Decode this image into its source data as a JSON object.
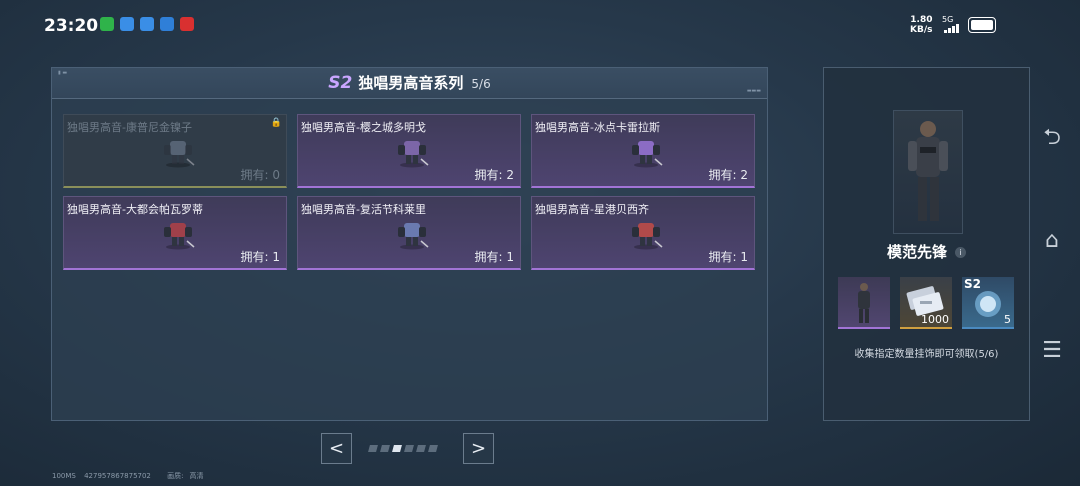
{
  "status": {
    "time": "23:20",
    "net_speed": "1.80",
    "net_unit": "KB/s",
    "signal": "5G"
  },
  "panel": {
    "season_tag": "S2",
    "title": "独唱男高音系列",
    "count": "5/6",
    "cards": [
      {
        "name": "独唱男高音-康普尼金镍子",
        "owned": "拥有: 0",
        "locked": true,
        "accent": "#7b8aa0"
      },
      {
        "name": "独唱男高音-樱之城多明戈",
        "owned": "拥有: 2",
        "locked": false,
        "accent": "#7c66a8"
      },
      {
        "name": "独唱男高音-冰点卡雷拉斯",
        "owned": "拥有: 2",
        "locked": false,
        "accent": "#8b6cc4"
      },
      {
        "name": "独唱男高音-大都会帕瓦罗蒂",
        "owned": "拥有: 1",
        "locked": false,
        "accent": "#a0404a"
      },
      {
        "name": "独唱男高音-复活节科莱里",
        "owned": "拥有: 1",
        "locked": false,
        "accent": "#6a7ab0"
      },
      {
        "name": "独唱男高音-星港贝西齐",
        "owned": "拥有: 1",
        "locked": false,
        "accent": "#b04a4a"
      }
    ]
  },
  "pager": {
    "prev": "<",
    "next": ">",
    "pages": 6,
    "current": 2
  },
  "footer": {
    "ping": "100MS",
    "uid": "427957867875702",
    "quality_label": "画质:",
    "quality_value": "高清"
  },
  "reward": {
    "name": "模范先锋",
    "items": [
      {
        "type": "character",
        "qty": "",
        "tag": ""
      },
      {
        "type": "voucher",
        "qty": "1000",
        "tag": ""
      },
      {
        "type": "s2-emblem",
        "qty": "5",
        "tag": "S2"
      }
    ],
    "description": "收集指定数量挂饰即可领取(5/6)"
  },
  "colors": {
    "rare": "#a274d6",
    "gold": "#d0a040",
    "blue": "#4a8ac0"
  }
}
